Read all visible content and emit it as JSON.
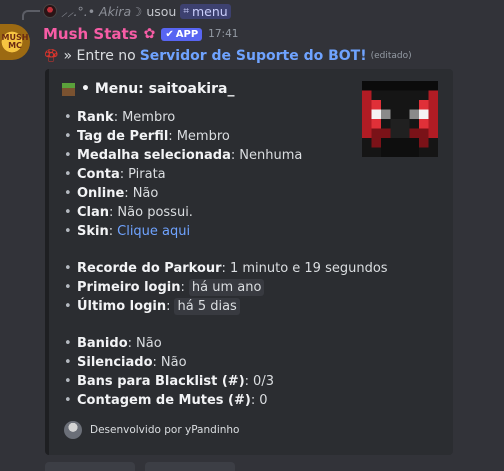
{
  "reply": {
    "username": "⸝⸝.°.• Akira☽",
    "used_text": "usou",
    "command": "menu"
  },
  "message": {
    "author": "Mush Stats",
    "app_badge": "APP",
    "timestamp": "17:41",
    "text_prefix": "» Entre no",
    "server_link": "Servidor de Suporte do BOT!",
    "edited": "(editado)"
  },
  "embed": {
    "title": "• Menu: saitoakira_",
    "fields": [
      {
        "key": "Rank",
        "value": "Membro",
        "style": "plain"
      },
      {
        "key": "Tag de Perfil",
        "value": "Membro",
        "style": "plain"
      },
      {
        "key": "Medalha selecionada",
        "value": "Nenhuma",
        "style": "plain"
      },
      {
        "key": "Conta",
        "value": "Pirata",
        "style": "plain"
      },
      {
        "key": "Online",
        "value": "Não",
        "style": "plain"
      },
      {
        "key": "Clan",
        "value": "Não possui.",
        "style": "plain"
      },
      {
        "key": "Skin",
        "value": "Clique aqui",
        "style": "link"
      },
      {
        "key": "Recorde do Parkour",
        "value": "1 minuto e 19 segundos",
        "style": "plain"
      },
      {
        "key": "Primeiro login",
        "value": "há um ano",
        "style": "code"
      },
      {
        "key": "Último login",
        "value": "há 5 dias",
        "style": "code"
      },
      {
        "key": "Banido",
        "value": "Não",
        "style": "plain"
      },
      {
        "key": "Silenciado",
        "value": "Não",
        "style": "plain"
      },
      {
        "key": "Bans para Blacklist (#)",
        "value": "0/3",
        "style": "plain"
      },
      {
        "key": "Contagem de Mutes (#)",
        "value": "0",
        "style": "plain"
      }
    ],
    "footer": "Desenvolvido por yPandinho"
  },
  "colors": {
    "background": "#323339",
    "embed_bg": "#2b2d31",
    "username": "#f75ca5",
    "link": "#6fa3ff",
    "app_badge": "#5865f2"
  },
  "icons": [
    "mushroom-icon",
    "grass-block-icon",
    "star-icon",
    "check-icon",
    "slash-command-icon"
  ]
}
